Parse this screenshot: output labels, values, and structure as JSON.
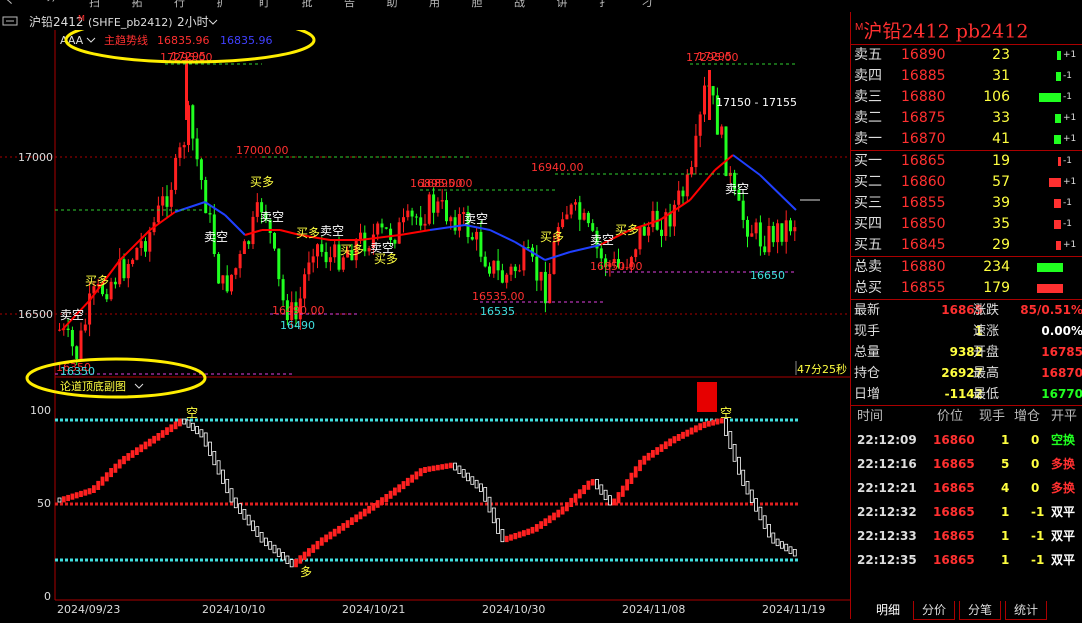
{
  "window": {
    "title_fragments": "丶 ⺈ 扫 拓 行 扩 盯 批 告 助 用 胆 战 讲 扌 刁"
  },
  "header": {
    "symbol": "沪铅2412",
    "flag": "M",
    "code": "(SHFE_pb2412)",
    "period": "2小时",
    "indicator_name": "AAA",
    "trend_label": "主趋势线",
    "trend_value_red": "16835.96",
    "trend_value_blue": "16835.96"
  },
  "chart": {
    "y_ticks": [
      "17000",
      "16500"
    ],
    "sub_y_ticks": [
      "100",
      "50",
      "0"
    ],
    "x_labels": [
      "2024/09/23",
      "2024/10/10",
      "2024/10/21",
      "2024/10/30",
      "2024/11/08",
      "2024/11/19"
    ],
    "subchart_title": "论道顶底副图",
    "time_remaining": "47分25秒",
    "annotations": {
      "high1": "17295.00",
      "high2": "17295.00",
      "high1b": "17295",
      "high2b": "17295",
      "range_label": "17150 - 17155",
      "level_17000": "17000.00",
      "level_16895": "16895.00",
      "level_16940": "16940.00",
      "level_16490a": "16490.00",
      "level_16490b": "16490",
      "level_16535a": "16535.00",
      "level_16535b": "16535",
      "level_16650a": "16650.00",
      "level_16650b": "16650",
      "level_16350a": "16350",
      "level_16350b": "16350",
      "sell_short": "卖空",
      "buy_long": "买多",
      "sub_sell": "空",
      "sub_buy": "多"
    },
    "colors": {
      "up": "#ff2020",
      "down": "#20ff20",
      "trend_up": "#ff0000",
      "trend_down": "#2020ff",
      "accent_yellow": "#ffff40",
      "cyan": "#40e0e0"
    }
  },
  "quote_panel": {
    "title": "沪铅2412 pb2412",
    "flag": "M",
    "asks": [
      {
        "label": "卖五",
        "price": "16890",
        "volume": "23",
        "change": "+1",
        "bar_color": "#20ff20",
        "bar_level": 0.15
      },
      {
        "label": "卖四",
        "price": "16885",
        "volume": "31",
        "change": "-1",
        "bar_color": "#20ff20",
        "bar_level": 0.2
      },
      {
        "label": "卖三",
        "price": "16880",
        "volume": "106",
        "change": "-1",
        "bar_color": "#20ff20",
        "bar_level": 0.85
      },
      {
        "label": "卖二",
        "price": "16875",
        "volume": "33",
        "change": "+1",
        "bar_color": "#20ff20",
        "bar_level": 0.22
      },
      {
        "label": "卖一",
        "price": "16870",
        "volume": "41",
        "change": "+1",
        "bar_color": "#20ff20",
        "bar_level": 0.28
      }
    ],
    "bids": [
      {
        "label": "买一",
        "price": "16865",
        "volume": "19",
        "change": "-1",
        "bar_color": "#ff3030",
        "bar_level": 0.12
      },
      {
        "label": "买二",
        "price": "16860",
        "volume": "57",
        "change": "+1",
        "bar_color": "#ff3030",
        "bar_level": 0.45
      },
      {
        "label": "买三",
        "price": "16855",
        "volume": "39",
        "change": "-1",
        "bar_color": "#ff3030",
        "bar_level": 0.28
      },
      {
        "label": "买四",
        "price": "16850",
        "volume": "35",
        "change": "-1",
        "bar_color": "#ff3030",
        "bar_level": 0.25
      },
      {
        "label": "买五",
        "price": "16845",
        "volume": "29",
        "change": "+1",
        "bar_color": "#ff3030",
        "bar_level": 0.2
      }
    ],
    "totals": [
      {
        "label": "总卖",
        "price": "16880",
        "volume": "234",
        "bar_color": "#20ff20",
        "bar_level": 0.9
      },
      {
        "label": "总买",
        "price": "16855",
        "volume": "179",
        "bar_color": "#ff3030",
        "bar_level": 0.9
      }
    ],
    "stats": [
      {
        "l1": "最新",
        "v1": "16865",
        "c1": "#ff3030",
        "l2": "涨跌",
        "v2": "85/0.51%",
        "c2": "#ff3030"
      },
      {
        "l1": "现手",
        "v1": "1",
        "c1": "#ffff40",
        "l2": "速涨",
        "v2": "0.00%",
        "c2": "#ffffff"
      },
      {
        "l1": "总量",
        "v1": "9382",
        "c1": "#ffff40",
        "l2": "开盘",
        "v2": "16785",
        "c2": "#ff3030"
      },
      {
        "l1": "持仓",
        "v1": "26927",
        "c1": "#ffff40",
        "l2": "最高",
        "v2": "16870",
        "c2": "#ff3030"
      },
      {
        "l1": "日增",
        "v1": "-1142",
        "c1": "#ffff40",
        "l2": "最低",
        "v2": "16770",
        "c2": "#20ff20"
      }
    ],
    "ticks_header": {
      "time": "时间",
      "price": "价位",
      "hand": "现手",
      "inc": "增仓",
      "type": "开平"
    },
    "ticks": [
      {
        "time": "22:12:09",
        "price": "16860",
        "hand": "1",
        "inc": "0",
        "type": "空换",
        "type_color": "#20ff20"
      },
      {
        "time": "22:12:16",
        "price": "16865",
        "hand": "5",
        "inc": "0",
        "type": "多换",
        "type_color": "#ff3030"
      },
      {
        "time": "22:12:21",
        "price": "16865",
        "hand": "4",
        "inc": "0",
        "type": "多换",
        "type_color": "#ff3030"
      },
      {
        "time": "22:12:32",
        "price": "16865",
        "hand": "1",
        "inc": "-1",
        "type": "双平",
        "type_color": "#ffffff"
      },
      {
        "time": "22:12:33",
        "price": "16865",
        "hand": "1",
        "inc": "-1",
        "type": "双平",
        "type_color": "#ffffff"
      },
      {
        "time": "22:12:35",
        "price": "16865",
        "hand": "1",
        "inc": "-1",
        "type": "双平",
        "type_color": "#ffffff"
      }
    ],
    "tabs": [
      "明细",
      "分价",
      "分笔",
      "统计"
    ]
  }
}
